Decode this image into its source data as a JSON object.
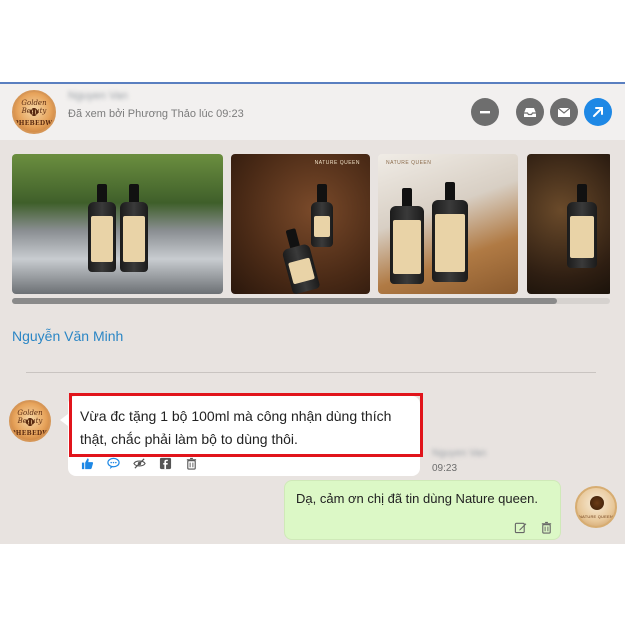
{
  "header": {
    "contact_name": "Nguyen Van",
    "seen_status": "Đã xem bởi Phương Thảo lúc 09:23",
    "buttons": [
      "minus-circle",
      "inbox",
      "mail",
      "open-external"
    ],
    "brand_logo": {
      "top": "Golden Beauty",
      "mark": "Φ",
      "bottom": "PHEBEDWS"
    }
  },
  "gallery": {
    "photo_count": 4,
    "brand_mark": "NATURE QUEEN"
  },
  "conversation": {
    "sender_name": "Nguyễn Văn Minh",
    "incoming": {
      "text": "Vừa đc tặng 1 bộ 100ml mà công nhận dùng thích thật, chắc phải làm bộ to dùng thôi.",
      "sender_blurred": "Nguyen Van",
      "time": "09:23",
      "actions": [
        "like-icon",
        "comment-icon",
        "hide-icon",
        "facebook-icon",
        "delete-icon"
      ]
    },
    "outgoing": {
      "text": "Dạ, cảm ơn chị đã tin dùng Nature queen.",
      "actions": [
        "edit-icon",
        "delete-icon"
      ],
      "avatar_label": "NATURE QUEEN"
    }
  },
  "colors": {
    "accent_blue": "#1e88e5",
    "name_blue": "#2b86c5",
    "highlight_red": "#e1141b",
    "outgoing_bubble": "#dcf8c6"
  }
}
